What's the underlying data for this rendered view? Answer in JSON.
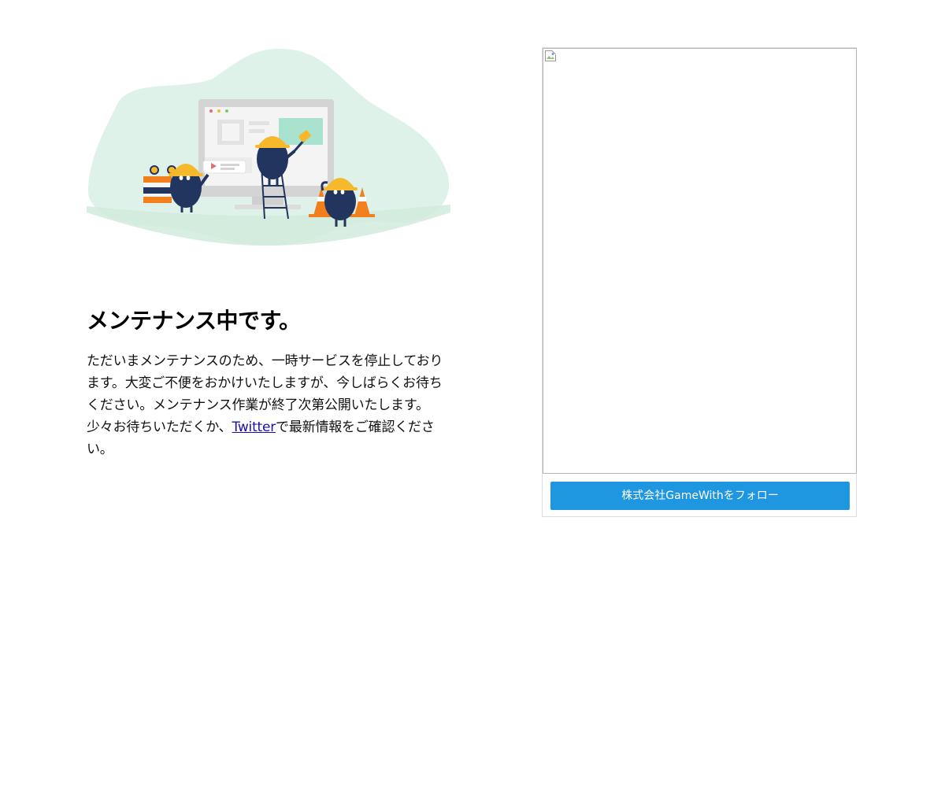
{
  "maintenance": {
    "title": "メンテナンス中です。",
    "message_part1": "ただいまメンテナンスのため、一時サービスを停止しております。大変ご不便をおかけいたしますが、今しばらくお待ちください。メンテナンス作業が終了次第公開いたします。少々お待ちいただくか、",
    "twitter_link": "Twitter",
    "message_part2": "で最新情報をご確認ください。"
  },
  "illustration": {
    "icon": "construction-workers-illustration",
    "colors": {
      "blob": "#dff2ea",
      "ground": "#d3ecdf",
      "monitor": "#d4d4d4",
      "screen": "#ebebeb",
      "accent": "#a9e2cf",
      "helmet": "#f5b92b",
      "character": "#22355e",
      "cone": "#f07f1c"
    }
  },
  "widget": {
    "broken_image_icon": "broken-image-icon",
    "follow_label": "株式会社GameWithをフォロー",
    "colors": {
      "button": "#1e96e0"
    }
  }
}
